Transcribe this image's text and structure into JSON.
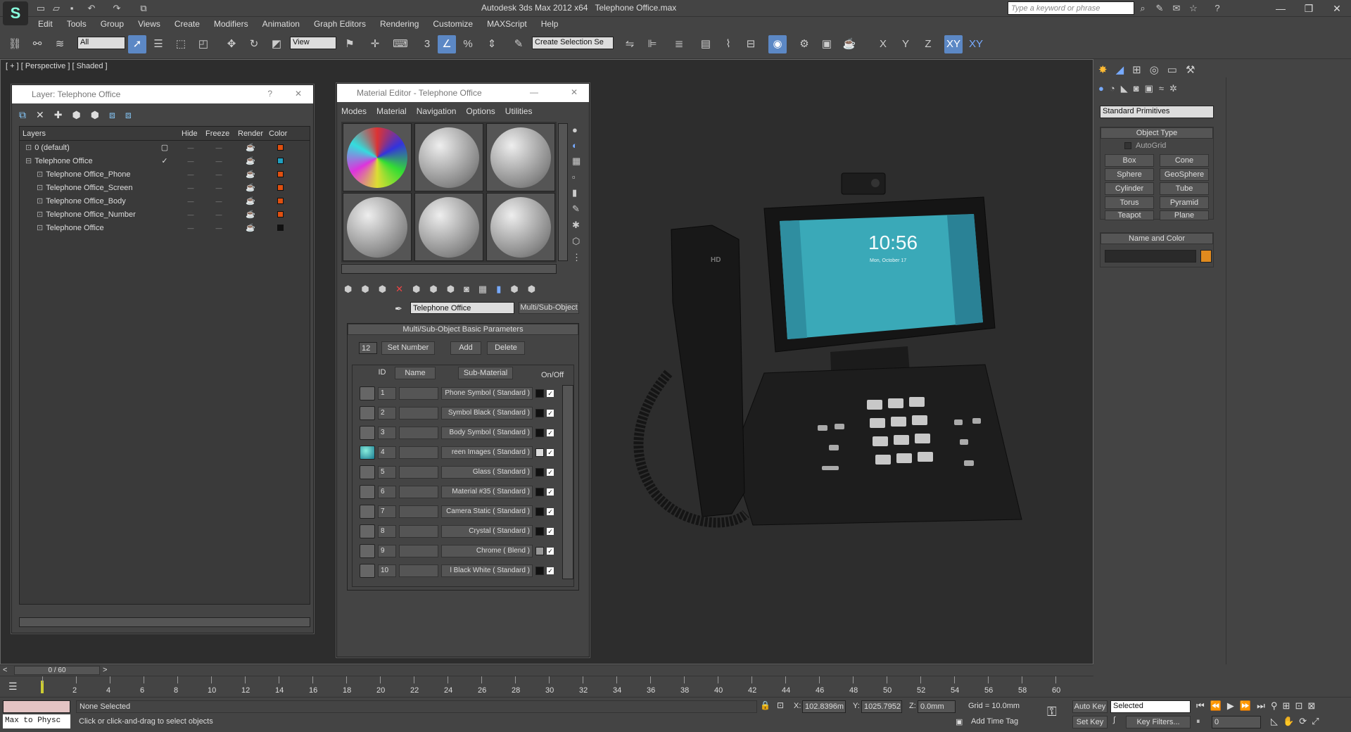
{
  "app": {
    "title": "Autodesk 3ds Max  2012 x64",
    "file": "Telephone Office.max",
    "search_placeholder": "Type a keyword or phrase"
  },
  "menu": [
    "Edit",
    "Tools",
    "Group",
    "Views",
    "Create",
    "Modifiers",
    "Animation",
    "Graph Editors",
    "Rendering",
    "Customize",
    "MAXScript",
    "Help"
  ],
  "toolbar": {
    "selection_filter": "All",
    "ref_coord": "View",
    "snap_label": "3",
    "selection_set": "Create Selection Se",
    "axis_x": "X",
    "axis_y": "Y",
    "axis_z": "Z",
    "axis_xy": "XY",
    "axis_xy2": "XY"
  },
  "viewport": {
    "label": "[ + ] [ Perspective ] [ Shaded ]",
    "screen_time": "10:56",
    "screen_date": "Mon, October 17",
    "brand": "HD"
  },
  "layer_panel": {
    "title": "Layer: Telephone Office",
    "help": "?",
    "close": "✕",
    "columns": [
      "Layers",
      "Hide",
      "Freeze",
      "Render",
      "Color"
    ],
    "rows": [
      {
        "name": "0 (default)",
        "color": "#e05010",
        "checked": "▢"
      },
      {
        "name": "Telephone Office",
        "color": "#20a0c0",
        "checked": "✓"
      },
      {
        "name": "Telephone Office_Phone",
        "color": "#e05010",
        "checked": ""
      },
      {
        "name": "Telephone Office_Screen",
        "color": "#e05010",
        "checked": ""
      },
      {
        "name": "Telephone Office_Body",
        "color": "#e05010",
        "checked": ""
      },
      {
        "name": "Telephone Office_Number",
        "color": "#e05010",
        "checked": ""
      },
      {
        "name": "Telephone Office",
        "color": "#111111",
        "checked": ""
      }
    ]
  },
  "material_editor": {
    "title": "Material Editor - Telephone Office",
    "menus": [
      "Modes",
      "Material",
      "Navigation",
      "Options",
      "Utilities"
    ],
    "material_name": "Telephone Office",
    "material_type": "Multi/Sub-Object",
    "rollout_title": "Multi/Sub-Object Basic Parameters",
    "count": "12",
    "set_number": "Set Number",
    "add": "Add",
    "delete": "Delete",
    "col_id": "ID",
    "col_name": "Name",
    "col_sub": "Sub-Material",
    "col_onoff": "On/Off",
    "rows": [
      {
        "id": "1",
        "sub": "Phone Symbol  ( Standard )",
        "color": "#111111"
      },
      {
        "id": "2",
        "sub": "Symbol Black  ( Standard )",
        "color": "#111111"
      },
      {
        "id": "3",
        "sub": "Body Symbol  ( Standard )",
        "color": "#111111"
      },
      {
        "id": "4",
        "sub": "reen Images  ( Standard )",
        "color": "#dddddd"
      },
      {
        "id": "5",
        "sub": "Glass  ( Standard )",
        "color": "#111111"
      },
      {
        "id": "6",
        "sub": "Material #35  ( Standard )",
        "color": "#111111"
      },
      {
        "id": "7",
        "sub": "Camera Static  ( Standard )",
        "color": "#111111"
      },
      {
        "id": "8",
        "sub": "Crystal  ( Standard )",
        "color": "#111111"
      },
      {
        "id": "9",
        "sub": "Chrome  ( Blend )",
        "color": "#999999"
      },
      {
        "id": "10",
        "sub": "l Black White  ( Standard )",
        "color": "#111111"
      }
    ]
  },
  "command_panel": {
    "dropdown": "Standard Primitives",
    "object_type": "Object Type",
    "autogrid": "AutoGrid",
    "buttons": [
      "Box",
      "Cone",
      "Sphere",
      "GeoSphere",
      "Cylinder",
      "Tube",
      "Torus",
      "Pyramid",
      "Teapot",
      "Plane"
    ],
    "name_and_color": "Name and Color",
    "swatch_color": "#e08a1e"
  },
  "timeline": {
    "frame": "0 / 60",
    "ticks": [
      "0",
      "2",
      "4",
      "6",
      "8",
      "10",
      "12",
      "14",
      "16",
      "18",
      "20",
      "22",
      "24",
      "26",
      "28",
      "30",
      "32",
      "34",
      "36",
      "38",
      "40",
      "42",
      "44",
      "46",
      "48",
      "50",
      "52",
      "54",
      "56",
      "58",
      "60"
    ]
  },
  "status": {
    "script_listener": "Max to Physc",
    "selection": "None Selected",
    "prompt": "Click or click-and-drag to select objects",
    "x": "102.8396m",
    "y": "1025.7952",
    "z": "0.0mm",
    "grid": "Grid = 10.0mm",
    "auto_key": "Auto Key",
    "selected": "Selected",
    "set_key": "Set Key",
    "key_filters": "Key Filters...",
    "add_time_tag": "Add Time Tag",
    "frame_field": "0"
  }
}
